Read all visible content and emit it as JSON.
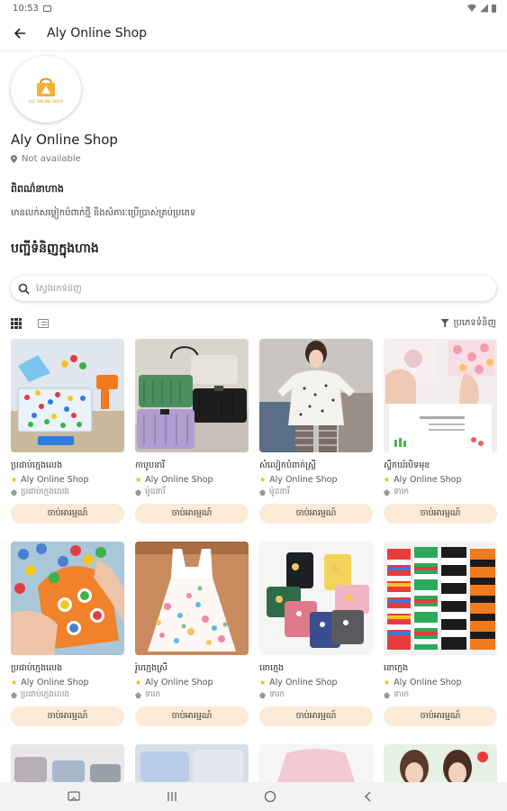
{
  "status_bar": {
    "time": "10:53"
  },
  "app_bar": {
    "title": "Aly Online Shop"
  },
  "shop": {
    "logo_text": "ALY ONLINE SHOP",
    "name": "Aly Online Shop",
    "location": "Not available",
    "description_heading": "ពិពណ៌នាហាង",
    "description": "មានលក់សម្លៀកបំពាក់ថ្មី និងសំភារៈប្រើប្រាស់គ្រប់ប្រភេទ"
  },
  "products_heading": "បញ្ជីទំនិញក្នុងហាង",
  "search": {
    "placeholder": "ស្វែងរកទំនិញ"
  },
  "sort_label": "ប្រភេទទំនិញ",
  "products": [
    {
      "title": "ប្រដាប់ក្មេងលេង",
      "shop": "Aly Online Shop",
      "category": "ប្រដាប់ក្មេងលេង",
      "button": "ចាប់អារម្មណ៍"
    },
    {
      "title": "កាបូបនារី",
      "shop": "Aly Online Shop",
      "category": "ម៉ូដនារី",
      "button": "ចាប់អារម្មណ៍"
    },
    {
      "title": "សំលៀកបំពាក់ស្ត្រី",
      "shop": "Aly Online Shop",
      "category": "ម៉ូដនារី",
      "button": "ចាប់អារម្មណ៍"
    },
    {
      "title": "ស្ទីកឃ័របិទមុខ",
      "shop": "Aly Online Shop",
      "category": "ទារក",
      "button": "ចាប់អារម្មណ៍"
    },
    {
      "title": "ប្រដាប់ក្មេងលេង",
      "shop": "Aly Online Shop",
      "category": "ប្រដាប់ក្មេងលេង",
      "button": "ចាប់អារម្មណ៍"
    },
    {
      "title": "រ៉ូបក្មេងស្រី",
      "shop": "Aly Online Shop",
      "category": "ទារក",
      "button": "ចាប់អារម្មណ៍"
    },
    {
      "title": "ខោក្មេង",
      "shop": "Aly Online Shop",
      "category": "ទារក",
      "button": "ចាប់អារម្មណ៍"
    },
    {
      "title": "ខោក្មេង",
      "shop": "Aly Online Shop",
      "category": "ទារក",
      "button": "ចាប់អារម្មណ៍"
    }
  ],
  "colors": {
    "accent": "#fbead6",
    "logo": "#e39a12",
    "star": "#f2b400"
  },
  "icons": [
    "back-arrow-icon",
    "location-pin-icon",
    "search-icon",
    "grid-view-icon",
    "list-view-icon",
    "filter-icon",
    "star-icon",
    "category-icon"
  ]
}
